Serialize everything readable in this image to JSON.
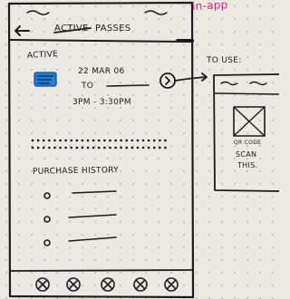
{
  "annotation": {
    "note": "in-app",
    "color": "#e0207a"
  },
  "header": {
    "back_icon": "arrow-left-icon",
    "title_crossed": "ACTIVE",
    "title": "PASSES"
  },
  "active_pass": {
    "section_label": "ACTIVE",
    "ticket_icon": "ticket-icon",
    "ticket_color": "#1f7fd6",
    "date_line": "22 MAR 06",
    "to_label": "TO",
    "time_range": "3PM - 3:30PM",
    "open_icon": "chevron-right-circle-icon"
  },
  "purchase_history": {
    "heading": "PURCHASE HISTORY",
    "bullet_icon": "circle-bullet-icon",
    "item_count": 3
  },
  "bottom_nav": {
    "icons": [
      "x-circle-icon",
      "x-circle-icon",
      "x-circle-icon",
      "x-circle-icon",
      "x-circle-icon"
    ]
  },
  "to_use_screen": {
    "label": "TO USE:",
    "qr_label": "QR CODE",
    "scan_line1": "SCAN",
    "scan_line2": "THIS."
  }
}
